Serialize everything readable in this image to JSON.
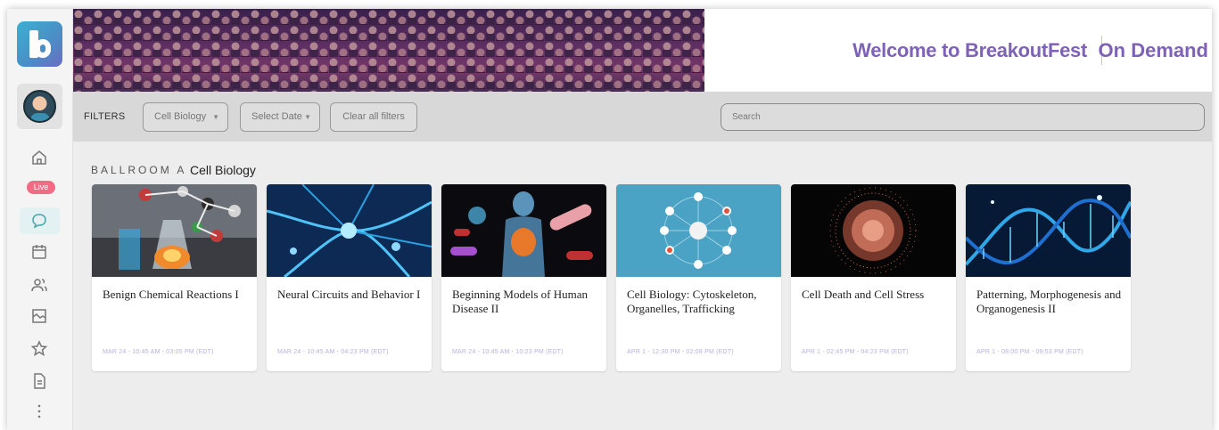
{
  "header": {
    "welcome": "Welcome to BreakoutFest",
    "mode": "On Demand"
  },
  "sidebar": {
    "live_badge": "Live",
    "icons": [
      "home-icon",
      "chat-icon",
      "calendar-icon",
      "people-icon",
      "gallery-icon",
      "star-icon",
      "document-icon",
      "more-icon"
    ]
  },
  "filters": {
    "label": "FILTERS",
    "category": "Cell Biology",
    "date": "Select Date",
    "clear": "Clear all filters",
    "search_placeholder": "Search"
  },
  "section": {
    "room": "BALLROOM A",
    "topic": "Cell Biology"
  },
  "sessions": [
    {
      "title": "Benign Chemical Reactions I",
      "time": "MAR 24 - 10:45 AM - 03:05 PM (EDT)"
    },
    {
      "title": "Neural Circuits and Behavior I",
      "time": "MAR 24 - 10:45 AM - 04:23 PM (EDT)"
    },
    {
      "title": "Beginning Models of Human Disease II",
      "time": "MAR 24 - 10:45 AM - 10:23 PM (EDT)"
    },
    {
      "title": "Cell Biology: Cytoskeleton, Organelles, Trafficking",
      "time": "APR 1 - 12:30 PM - 02:08 PM (EDT)"
    },
    {
      "title": "Cell Death and Cell Stress",
      "time": "APR 1 - 02:45 PM - 04:23 PM (EDT)"
    },
    {
      "title": "Patterning, Morphogenesis and Organogenesis II",
      "time": "APR 1 - 08:00 PM - 09:53 PM (EDT)"
    }
  ],
  "colors": {
    "accent": "#7d62b8",
    "live": "#ef6c84",
    "time_text": "#b9b1dc"
  }
}
